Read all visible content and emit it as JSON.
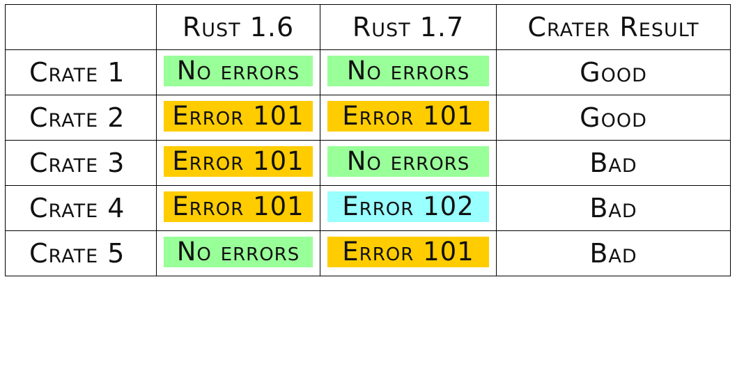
{
  "colors": {
    "no_errors": "#99ff99",
    "error_101": "#ffcc00",
    "error_102": "#99ffff"
  },
  "header": {
    "corner": "",
    "col1": "Rust 1.6",
    "col2": "Rust 1.7",
    "col3": "Crater Result"
  },
  "rows": [
    {
      "crate": "Crate 1",
      "rust16": "No errors",
      "rust16_status": "no_errors",
      "rust17": "No errors",
      "rust17_status": "no_errors",
      "result": "Good"
    },
    {
      "crate": "Crate 2",
      "rust16": "Error 101",
      "rust16_status": "error_101",
      "rust17": "Error 101",
      "rust17_status": "error_101",
      "result": "Good"
    },
    {
      "crate": "Crate 3",
      "rust16": "Error 101",
      "rust16_status": "error_101",
      "rust17": "No errors",
      "rust17_status": "no_errors",
      "result": "Bad"
    },
    {
      "crate": "Crate 4",
      "rust16": "Error 101",
      "rust16_status": "error_101",
      "rust17": "Error 102",
      "rust17_status": "error_102",
      "result": "Bad"
    },
    {
      "crate": "Crate 5",
      "rust16": "No errors",
      "rust16_status": "no_errors",
      "rust17": "Error 101",
      "rust17_status": "error_101",
      "result": "Bad"
    }
  ]
}
